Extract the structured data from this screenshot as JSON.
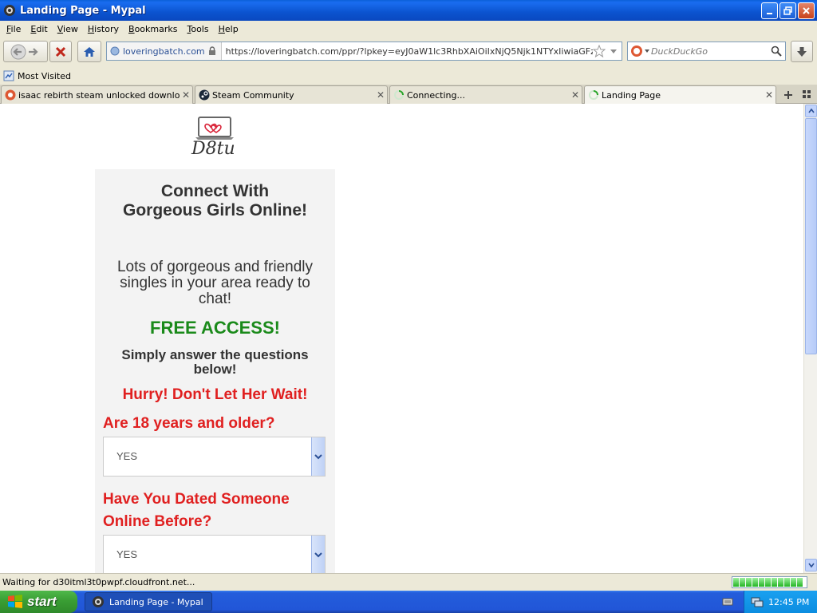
{
  "window": {
    "title": "Landing Page - Mypal"
  },
  "menu": [
    "File",
    "Edit",
    "View",
    "History",
    "Bookmarks",
    "Tools",
    "Help"
  ],
  "navbar": {
    "identity": "loveringbatch.com",
    "url": "https://loveringbatch.com/ppr/?lpkey=eyJ0aW1lc3RhbXAiOiIxNjQ5Njk1NTYxIiwiaGFzaCI6IjYyM",
    "search_placeholder": "DuckDuckGo"
  },
  "bookmarks": {
    "most_visited": "Most Visited"
  },
  "tabs": [
    {
      "label": "isaac rebirth steam unlocked download ..."
    },
    {
      "label": "Steam Community"
    },
    {
      "label": "Connecting..."
    },
    {
      "label": "Landing Page"
    }
  ],
  "page": {
    "logo_text": "D8tu",
    "headline_1": "Connect With",
    "headline_2": "Gorgeous Girls Online!",
    "subtext_1": "Lots of gorgeous and friendly",
    "subtext_2": "singles in your area ready to",
    "subtext_3": "chat!",
    "free_access": "FREE ACCESS!",
    "simply_1": "Simply answer the questions",
    "simply_2": "below!",
    "hurry": "Hurry! Don't Let Her Wait!",
    "q1": "Are 18 years and older?",
    "q1_value": "YES",
    "q2_line1": "Have You Dated Someone",
    "q2_line2": "Online Before?",
    "q2_value": "YES"
  },
  "status": {
    "text": "Waiting for d30itml3t0pwpf.cloudfront.net..."
  },
  "taskbar": {
    "start": "start",
    "task_item": "Landing Page - Mypal",
    "clock": "12:45 PM"
  },
  "colors": {
    "accent_red": "#e02020",
    "accent_green": "#1a8a1a"
  }
}
